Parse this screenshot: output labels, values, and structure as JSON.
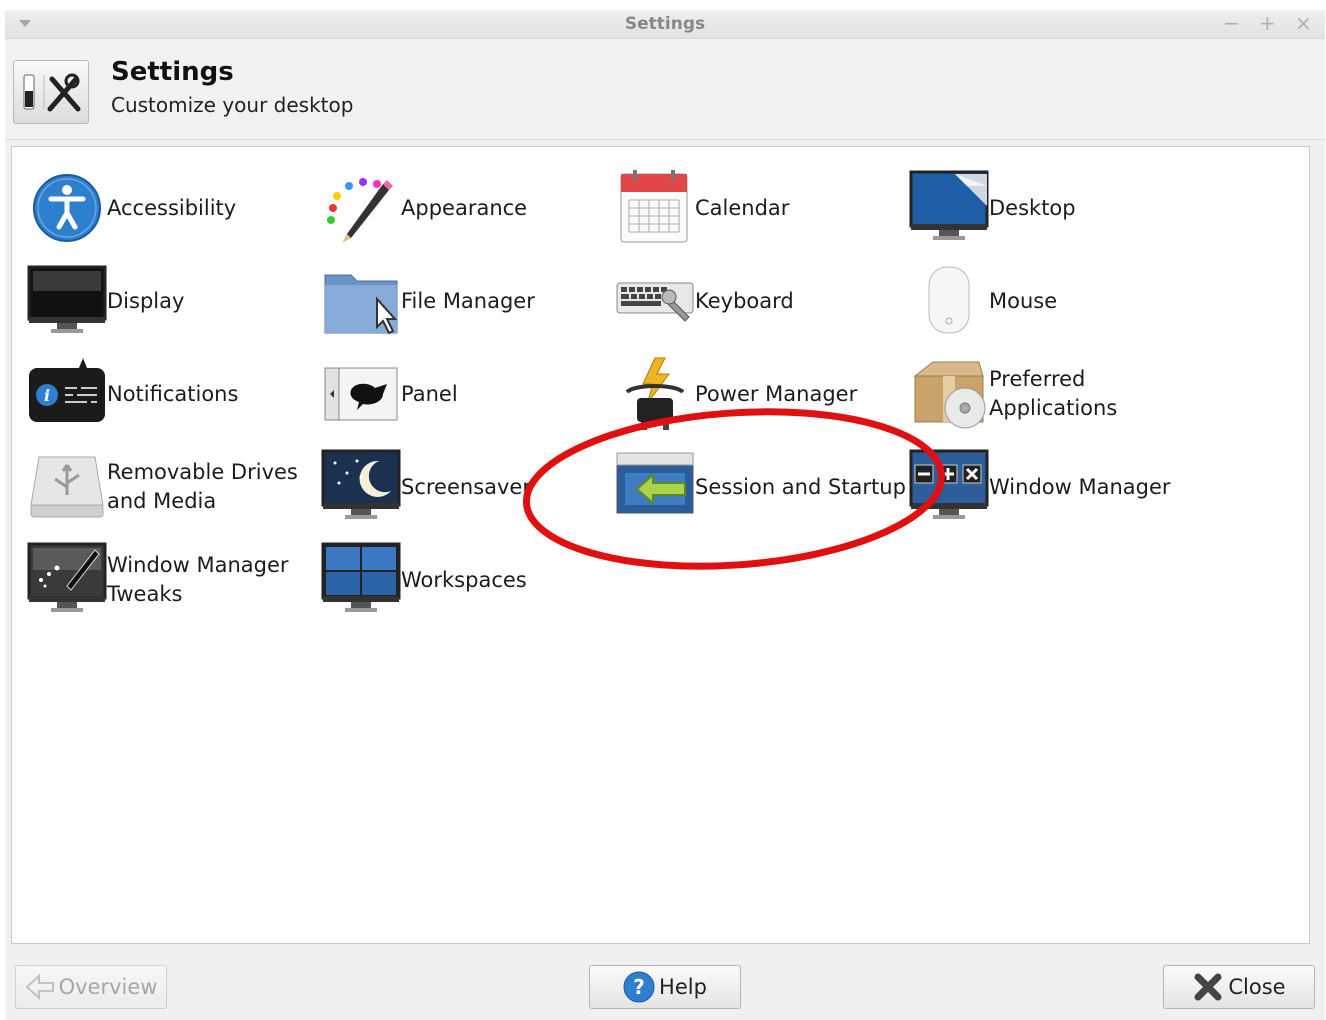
{
  "window": {
    "title": "Settings"
  },
  "header": {
    "title": "Settings",
    "subtitle": "Customize your desktop"
  },
  "items": [
    {
      "label": "Accessibility",
      "icon": "accessibility-icon"
    },
    {
      "label": "Appearance",
      "icon": "appearance-icon"
    },
    {
      "label": "Calendar",
      "icon": "calendar-icon"
    },
    {
      "label": "Desktop",
      "icon": "desktop-icon"
    },
    {
      "label": "Display",
      "icon": "display-icon"
    },
    {
      "label": "File Manager",
      "icon": "file-manager-icon"
    },
    {
      "label": "Keyboard",
      "icon": "keyboard-icon"
    },
    {
      "label": "Mouse",
      "icon": "mouse-icon"
    },
    {
      "label": "Notifications",
      "icon": "notifications-icon"
    },
    {
      "label": "Panel",
      "icon": "panel-icon"
    },
    {
      "label": "Power Manager",
      "icon": "power-manager-icon"
    },
    {
      "label": "Preferred\nApplications",
      "icon": "preferred-applications-icon"
    },
    {
      "label": "Removable Drives\nand Media",
      "icon": "removable-drives-icon"
    },
    {
      "label": "Screensaver",
      "icon": "screensaver-icon"
    },
    {
      "label": "Session and Startup",
      "icon": "session-startup-icon"
    },
    {
      "label": "Window Manager",
      "icon": "window-manager-icon"
    },
    {
      "label": "Window Manager\nTweaks",
      "icon": "window-manager-tweaks-icon"
    },
    {
      "label": "Workspaces",
      "icon": "workspaces-icon"
    }
  ],
  "buttons": {
    "overview": "Overview",
    "help": "Help",
    "close": "Close"
  },
  "colors": {
    "highlight": "#e01010",
    "accent_blue": "#2a6db5"
  }
}
